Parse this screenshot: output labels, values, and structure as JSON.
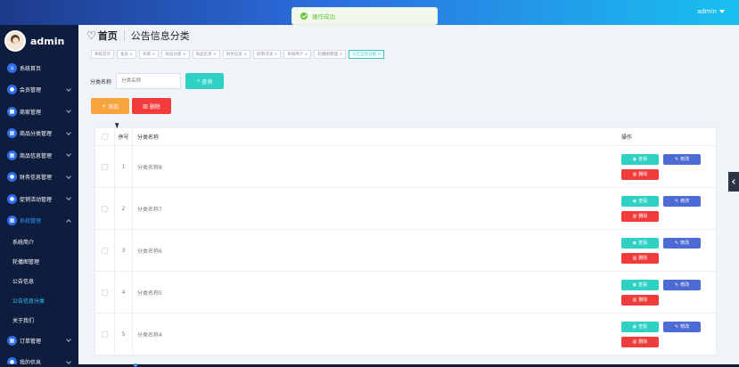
{
  "header": {
    "user": "admin"
  },
  "toast": {
    "message": "操作成功"
  },
  "sidebar": {
    "brand": "admin",
    "items": [
      {
        "label": "系统首页",
        "icon": "home-icon",
        "glyph": "⌂",
        "has_arrow": false
      },
      {
        "label": "会员管理",
        "icon": "member-icon",
        "glyph": "●",
        "has_arrow": true
      },
      {
        "label": "商家管理",
        "icon": "store-icon",
        "glyph": "■",
        "has_arrow": true
      },
      {
        "label": "商品分类管理",
        "icon": "category-icon",
        "glyph": "▦",
        "has_arrow": true
      },
      {
        "label": "商品信息管理",
        "icon": "goods-icon",
        "glyph": "▦",
        "has_arrow": true
      },
      {
        "label": "财务信息管理",
        "icon": "finance-icon",
        "glyph": "●",
        "has_arrow": true
      },
      {
        "label": "促销活动管理",
        "icon": "promotion-icon",
        "glyph": "●",
        "has_arrow": true
      },
      {
        "label": "系统管理",
        "icon": "system-icon",
        "glyph": "▦",
        "has_arrow": true,
        "open": true
      }
    ],
    "subitems": [
      {
        "label": "系统简介",
        "active": false
      },
      {
        "label": "轮播图管理",
        "active": false
      },
      {
        "label": "公告信息",
        "active": false
      },
      {
        "label": "公告信息分类",
        "active": true
      },
      {
        "label": "关于我们",
        "active": false
      }
    ],
    "after_items": [
      {
        "label": "订单管理",
        "icon": "order-icon",
        "glyph": "▦",
        "has_arrow": true
      },
      {
        "label": "我的信息",
        "icon": "profile-icon",
        "glyph": "●",
        "has_arrow": true
      }
    ]
  },
  "page": {
    "home": "首页",
    "title": "公告信息分类"
  },
  "tabs": [
    {
      "label": "系统首页",
      "active": false
    },
    {
      "label": "会员 ×",
      "active": false
    },
    {
      "label": "商家 ×",
      "active": false
    },
    {
      "label": "商品分类 ×",
      "active": false
    },
    {
      "label": "商品信息 ×",
      "active": false
    },
    {
      "label": "财务信息 ×",
      "active": false
    },
    {
      "label": "促销活动 ×",
      "active": false
    },
    {
      "label": "系统简介 ×",
      "active": false
    },
    {
      "label": "轮播图管理 ×",
      "active": false
    },
    {
      "label": "公告信息分类 ×",
      "active": true
    }
  ],
  "search": {
    "label": "分类名称",
    "placeholder": "分类名称",
    "button": "查询"
  },
  "actions": {
    "add": "添加",
    "delete": "删除"
  },
  "table": {
    "headers": {
      "index": "序号",
      "name": "分类名称",
      "ops": "操作"
    },
    "ops": {
      "view": "查看",
      "edit": "修改",
      "delete": "删除"
    },
    "rows": [
      {
        "index": "1",
        "name": "分类名称8"
      },
      {
        "index": "2",
        "name": "分类名称7"
      },
      {
        "index": "3",
        "name": "分类名称6"
      },
      {
        "index": "4",
        "name": "分类名称5"
      },
      {
        "index": "5",
        "name": "分类名称4"
      }
    ]
  }
}
